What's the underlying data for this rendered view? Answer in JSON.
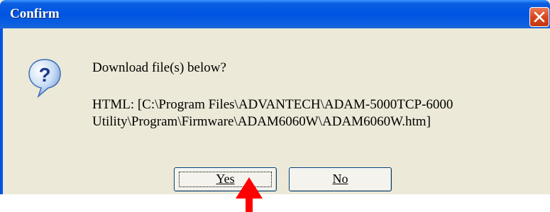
{
  "dialog": {
    "title": "Confirm",
    "message": "Download file(s) below?",
    "path_text": "HTML:  [C:\\Program Files\\ADVANTECH\\ADAM-5000TCP-6000 Utility\\Program\\Firmware\\ADAM6060W\\ADAM6060W.htm]",
    "icon": "question-icon",
    "buttons": {
      "yes": "Yes",
      "no": "No"
    }
  },
  "colors": {
    "titlebar": "#0054e3",
    "dialog_bg": "#ece9d8",
    "close": "#d9471d",
    "annotation_arrow": "#ff0000"
  }
}
